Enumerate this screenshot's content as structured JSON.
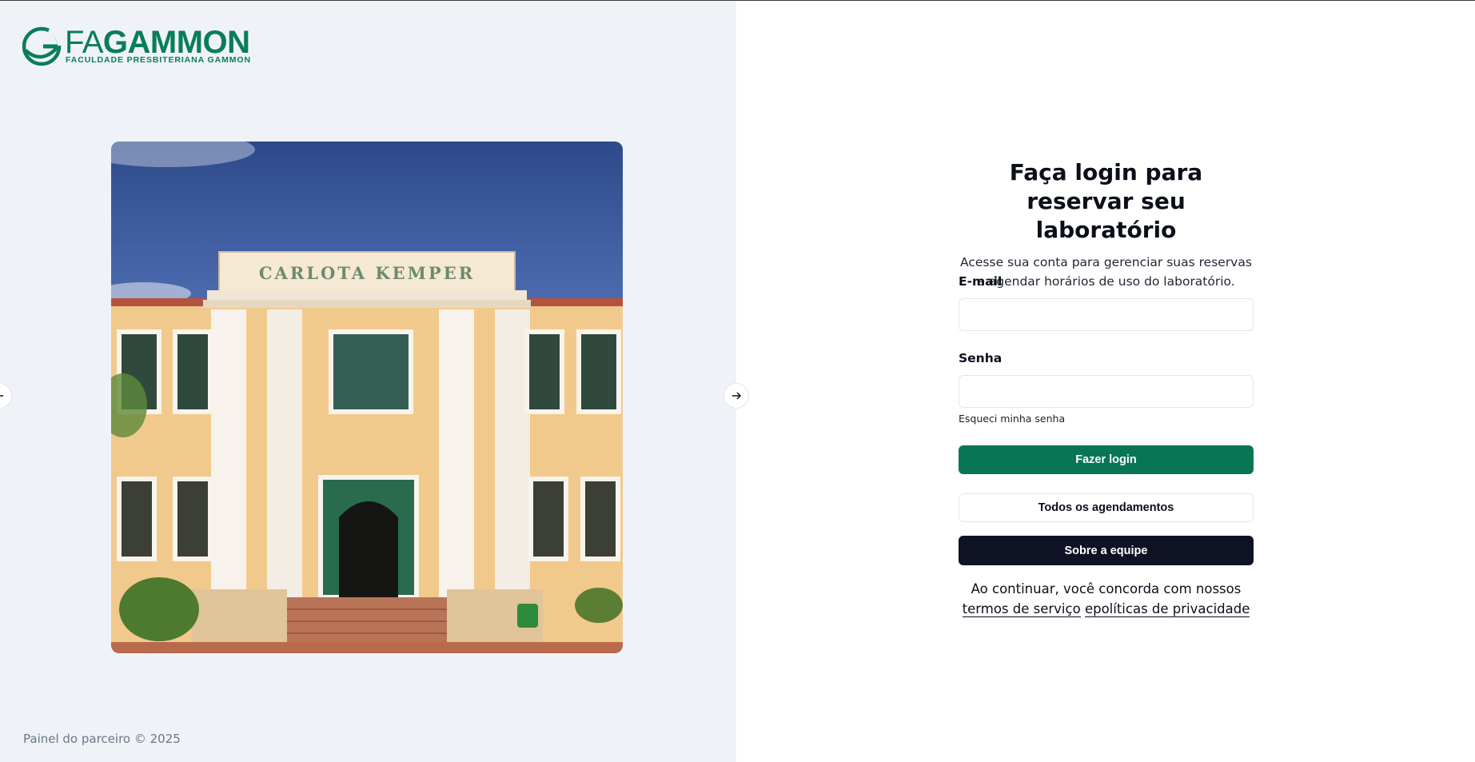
{
  "brand": {
    "name_prefix": "FA",
    "name_main": "GAMMON",
    "tagline": "FACULDADE PRESBITERIANA GAMMON",
    "color": "#0a7d5a"
  },
  "carousel": {
    "building_sign": "CARLOTA KEMPER",
    "prev_icon": "arrow-left-icon",
    "next_icon": "arrow-right-icon"
  },
  "footer": {
    "copyright": "Painel do parceiro © 2025"
  },
  "login": {
    "title": "Faça login para reservar seu laboratório",
    "subtitle": "Acesse sua conta para gerenciar suas reservas e agendar horários de uso do laboratório.",
    "email_label": "E-mail",
    "email_value": "",
    "password_label": "Senha",
    "password_value": "",
    "forgot_password": "Esqueci minha senha",
    "login_button": "Fazer login",
    "all_schedules_button": "Todos os agendamentos",
    "about_team_button": "Sobre a equipe",
    "terms_prefix": "Ao continuar, você concorda com nossos",
    "terms_link": "termos de serviço",
    "privacy_link": "epolíticas de privacidade"
  },
  "colors": {
    "primary": "#087655",
    "dark_button": "#0f1125",
    "left_panel_bg": "#eff3f8"
  }
}
